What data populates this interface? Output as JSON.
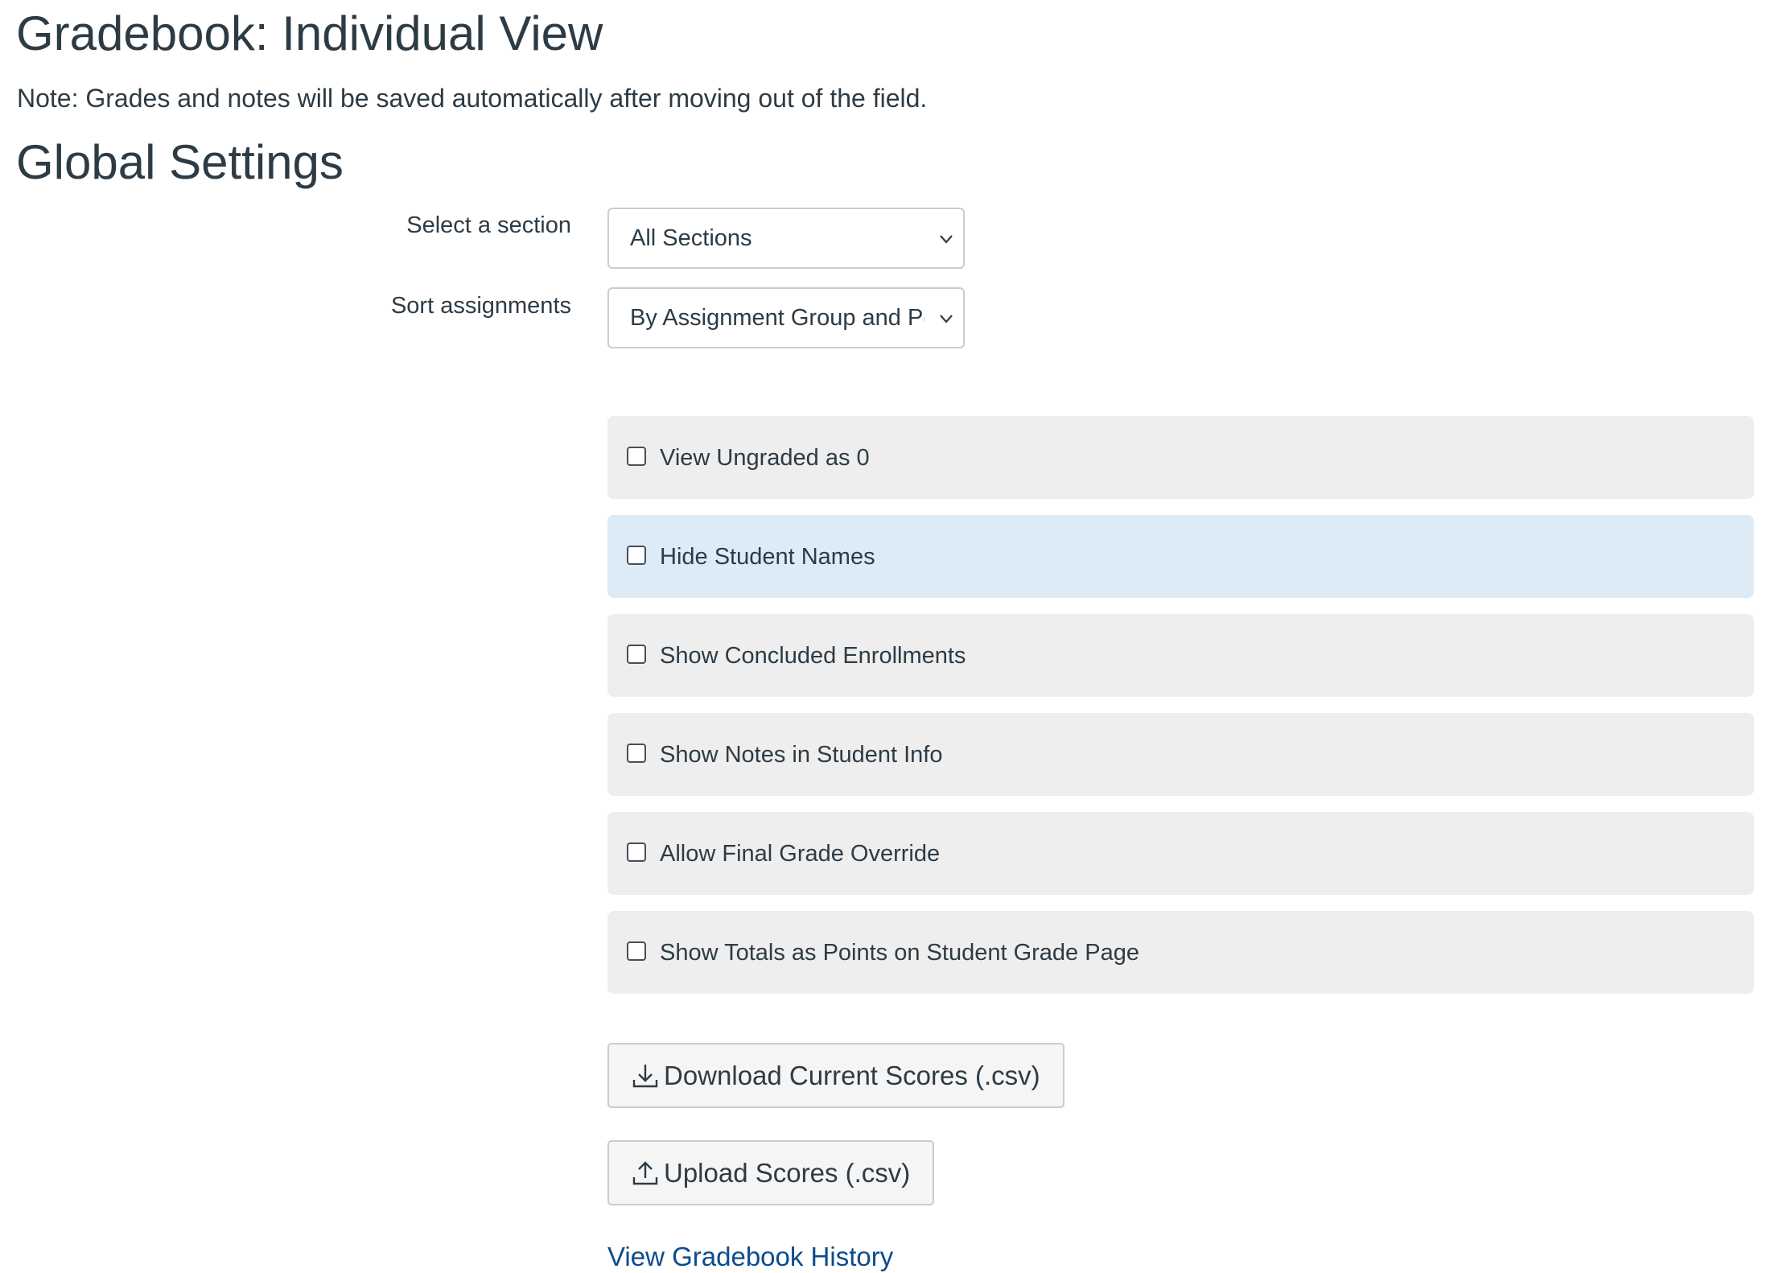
{
  "page": {
    "title": "Gradebook: Individual View",
    "note": "Note: Grades and notes will be saved automatically after moving out of the field."
  },
  "global_settings": {
    "heading": "Global Settings",
    "section_select": {
      "label": "Select a section",
      "value": "All Sections"
    },
    "sort_select": {
      "label": "Sort assignments",
      "value": "By Assignment Group and Position"
    },
    "options": [
      {
        "label": "View Ungraded as 0",
        "checked": false
      },
      {
        "label": "Hide Student Names",
        "checked": false,
        "highlighted": true
      },
      {
        "label": "Show Concluded Enrollments",
        "checked": false
      },
      {
        "label": "Show Notes in Student Info",
        "checked": false
      },
      {
        "label": "Allow Final Grade Override",
        "checked": false
      },
      {
        "label": "Show Totals as Points on Student Grade Page",
        "checked": false
      }
    ],
    "download_button": {
      "label": "Download Current Scores (.csv)",
      "icon": "download-icon"
    },
    "upload_button": {
      "label": "Upload Scores (.csv)",
      "icon": "upload-icon"
    },
    "history_link": {
      "label": "View Gradebook History"
    }
  },
  "colors": {
    "text": "#2d3b45",
    "panel": "#eeeeee",
    "panel_highlight": "#ddebf6",
    "link": "#0b4c8c",
    "border": "#c7cdd1"
  }
}
